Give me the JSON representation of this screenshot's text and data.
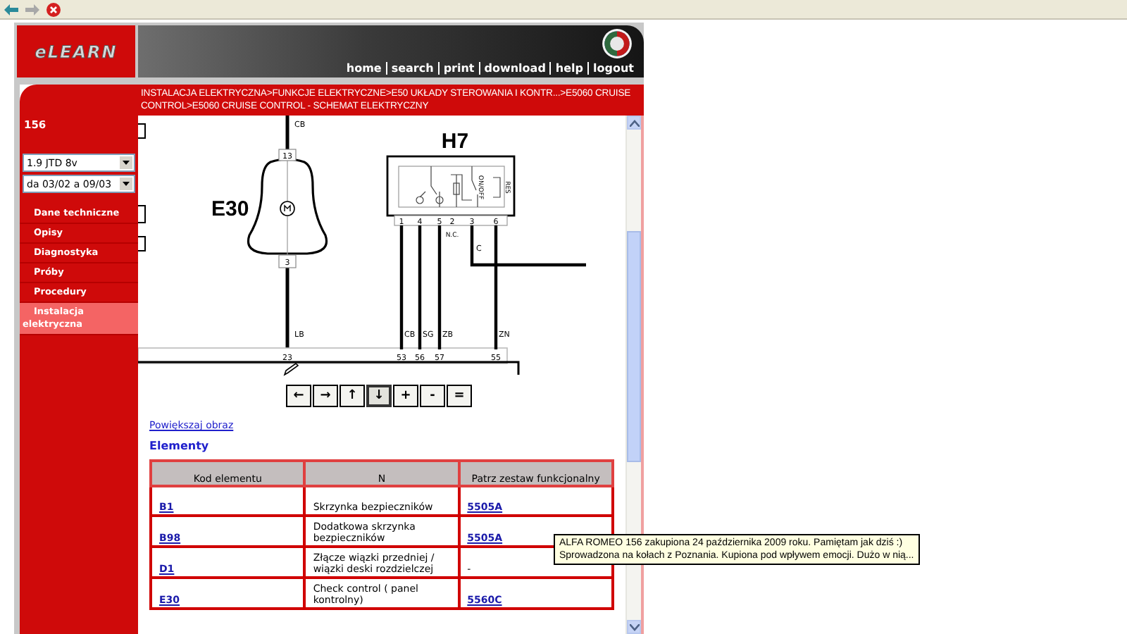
{
  "toolbar": {
    "buttons": [
      {
        "kind": "back",
        "disabled": false
      },
      {
        "kind": "forward",
        "disabled": true
      },
      {
        "kind": "stop",
        "disabled": false
      }
    ]
  },
  "header": {
    "logo": "eLEARN",
    "nav_links": [
      "home",
      "search",
      "print",
      "download",
      "help",
      "logout"
    ]
  },
  "breadcrumb": "INSTALACJA ELEKTRYCZNA>FUNKCJE ELEKTRYCZNE>E50 UKŁADY STEROWANIA I KONTR...>E5060 CRUISE CONTROL>E5060 CRUISE CONTROL - SCHEMAT ELEKTRYCZNY",
  "sidebar": {
    "model": "156",
    "selects": [
      "1.9 JTD 8v",
      "da 03/02 a 09/03"
    ],
    "items": [
      {
        "label": "Dane techniczne",
        "selected": false
      },
      {
        "label": "Opisy",
        "selected": false
      },
      {
        "label": "Diagnostyka",
        "selected": false
      },
      {
        "label": "Próby",
        "selected": false
      },
      {
        "label": "Procedury",
        "selected": false
      },
      {
        "label": "Instalacja elektryczna",
        "selected": true
      }
    ]
  },
  "diagram": {
    "component_labels": [
      "E30",
      "H7"
    ],
    "e30_pins": [
      "13",
      "3"
    ],
    "e30_wires": [
      "CB",
      "LB"
    ],
    "e30_connector": "23",
    "h7_pins": [
      "1",
      "4",
      "5",
      "2",
      "3",
      "6"
    ],
    "h7_pin_notes": [
      "N.C.",
      "C"
    ],
    "switch_labels": [
      "ON/OFF",
      "RES"
    ],
    "h7_wires": [
      "CB",
      "SG",
      "ZB",
      "ZN"
    ],
    "h7_connectors": [
      "53",
      "56",
      "57",
      "55"
    ]
  },
  "nav_buttons": [
    {
      "label": "←",
      "selected": false
    },
    {
      "label": "→",
      "selected": false
    },
    {
      "label": "↑",
      "selected": false
    },
    {
      "label": "↓",
      "selected": true
    },
    {
      "label": "+",
      "selected": false
    },
    {
      "label": "-",
      "selected": false
    },
    {
      "label": "=",
      "selected": false
    }
  ],
  "enlarge_link": "Powiększaj obraz",
  "section_title": "Elementy",
  "table": {
    "columns": [
      "Kod elementu",
      "N",
      "Patrz zestaw funkcjonalny"
    ],
    "rows": [
      {
        "code": "B1",
        "name": "Skrzynka bezpieczników",
        "ref": {
          "text": "5505A",
          "kind": "link"
        }
      },
      {
        "code": "B98",
        "name": "Dodatkowa skrzynka bezpieczników",
        "ref": {
          "text": "5505A",
          "kind": "link"
        }
      },
      {
        "code": "D1",
        "name": "Złącze wiązki przedniej / wiązki deski rozdzielczej",
        "ref": {
          "text": "-",
          "kind": "text"
        }
      },
      {
        "code": "E30",
        "name": "Check control ( panel kontrolny)",
        "ref": {
          "text": "5560C",
          "kind": "link"
        }
      }
    ]
  },
  "tooltip": {
    "lines": [
      "ALFA ROMEO 156 zakupiona 24 października 2009 roku. Pamiętam jak dziś :)",
      "Sprowadzona na kołach z Poznania.  Kupiona pod wpływem emocji. Dużo w nią..."
    ]
  }
}
